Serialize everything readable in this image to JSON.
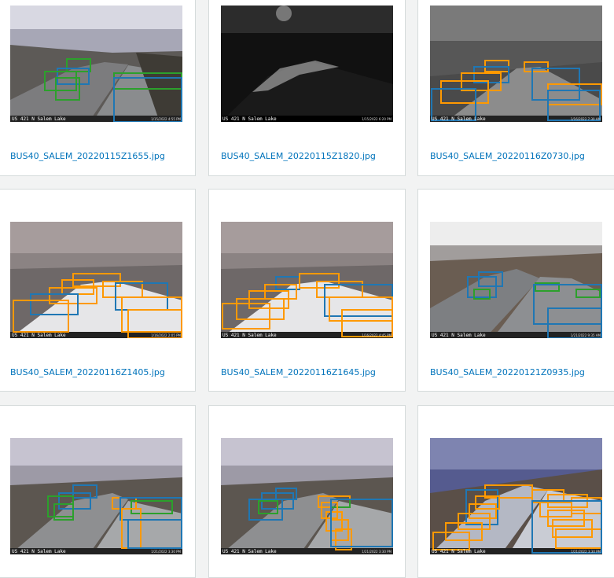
{
  "colors": {
    "class_a": "#ff9900",
    "class_b": "#1f77b4",
    "class_c": "#2ca02c",
    "link": "#0073bb"
  },
  "gallery": {
    "images": [
      {
        "filename": "BUS40_SALEM_20220115Z1655.jpg",
        "caption": "US 421 N Salem Lake",
        "timestamp": "1/15/2022 4:55 PM",
        "scene": "day"
      },
      {
        "filename": "BUS40_SALEM_20220115Z1820.jpg",
        "caption": "US 421 N Salem Lake",
        "timestamp": "1/15/2022 6:20 PM",
        "scene": "night"
      },
      {
        "filename": "BUS40_SALEM_20220116Z0730.jpg",
        "caption": "US 421 N Salem Lake",
        "timestamp": "1/16/2022 7:30 AM",
        "scene": "fog"
      },
      {
        "filename": "BUS40_SALEM_20220116Z1405.jpg",
        "caption": "US 421 N Salem Lake",
        "timestamp": "1/16/2022 2:05 PM",
        "scene": "snow"
      },
      {
        "filename": "BUS40_SALEM_20220116Z1645.jpg",
        "caption": "US 421 N Salem Lake",
        "timestamp": "1/16/2022 4:45 PM",
        "scene": "snow"
      },
      {
        "filename": "BUS40_SALEM_20220121Z0935.jpg",
        "caption": "US 421 N Salem Lake",
        "timestamp": "1/21/2022 9:35 AM",
        "scene": "clear"
      },
      {
        "filename": "",
        "caption": "US 421 N Salem Lake",
        "timestamp": "1/21/2022 3:30 PM",
        "scene": "day"
      },
      {
        "filename": "",
        "caption": "US 421 N Salem Lake",
        "timestamp": "1/21/2022 3:30 PM",
        "scene": "day"
      },
      {
        "filename": "",
        "caption": "US 421 N Salem Lake",
        "timestamp": "1/21/2022 3:30 PM",
        "scene": "clear"
      }
    ]
  }
}
